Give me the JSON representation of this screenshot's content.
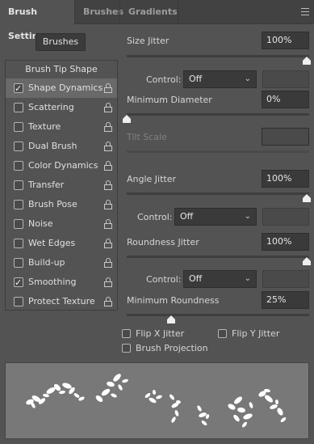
{
  "tabs": [
    "Brush Settings",
    "Brushes",
    "Gradients"
  ],
  "brushes_button": "Brushes",
  "brush_tip_shape": "Brush Tip Shape",
  "options": [
    {
      "label": "Shape Dynamics",
      "checked": true,
      "selected": true
    },
    {
      "label": "Scattering",
      "checked": false
    },
    {
      "label": "Texture",
      "checked": false
    },
    {
      "label": "Dual Brush",
      "checked": false
    },
    {
      "label": "Color Dynamics",
      "checked": false
    },
    {
      "label": "Transfer",
      "checked": false
    },
    {
      "label": "Brush Pose",
      "checked": false
    },
    {
      "label": "Noise",
      "checked": false
    },
    {
      "label": "Wet Edges",
      "checked": false
    },
    {
      "label": "Build-up",
      "checked": false
    },
    {
      "label": "Smoothing",
      "checked": true
    },
    {
      "label": "Protect Texture",
      "checked": false
    }
  ],
  "settings": {
    "size_jitter": {
      "label": "Size Jitter",
      "value": "100%"
    },
    "control_1": {
      "label": "Control:",
      "value": "Off"
    },
    "min_diameter": {
      "label": "Minimum Diameter",
      "value": "0%"
    },
    "tilt_scale": {
      "label": "Tilt Scale"
    },
    "angle_jitter": {
      "label": "Angle Jitter",
      "value": "100%"
    },
    "control_2": {
      "label": "Control:",
      "value": "Off"
    },
    "roundness_jitter": {
      "label": "Roundness Jitter",
      "value": "100%"
    },
    "control_3": {
      "label": "Control:",
      "value": "Off"
    },
    "min_roundness": {
      "label": "Minimum Roundness",
      "value": "25%"
    },
    "flip_x": "Flip X Jitter",
    "flip_y": "Flip Y Jitter",
    "brush_projection": "Brush Projection"
  },
  "colors": {
    "panel": "#535353",
    "accent": "#ffffff"
  }
}
